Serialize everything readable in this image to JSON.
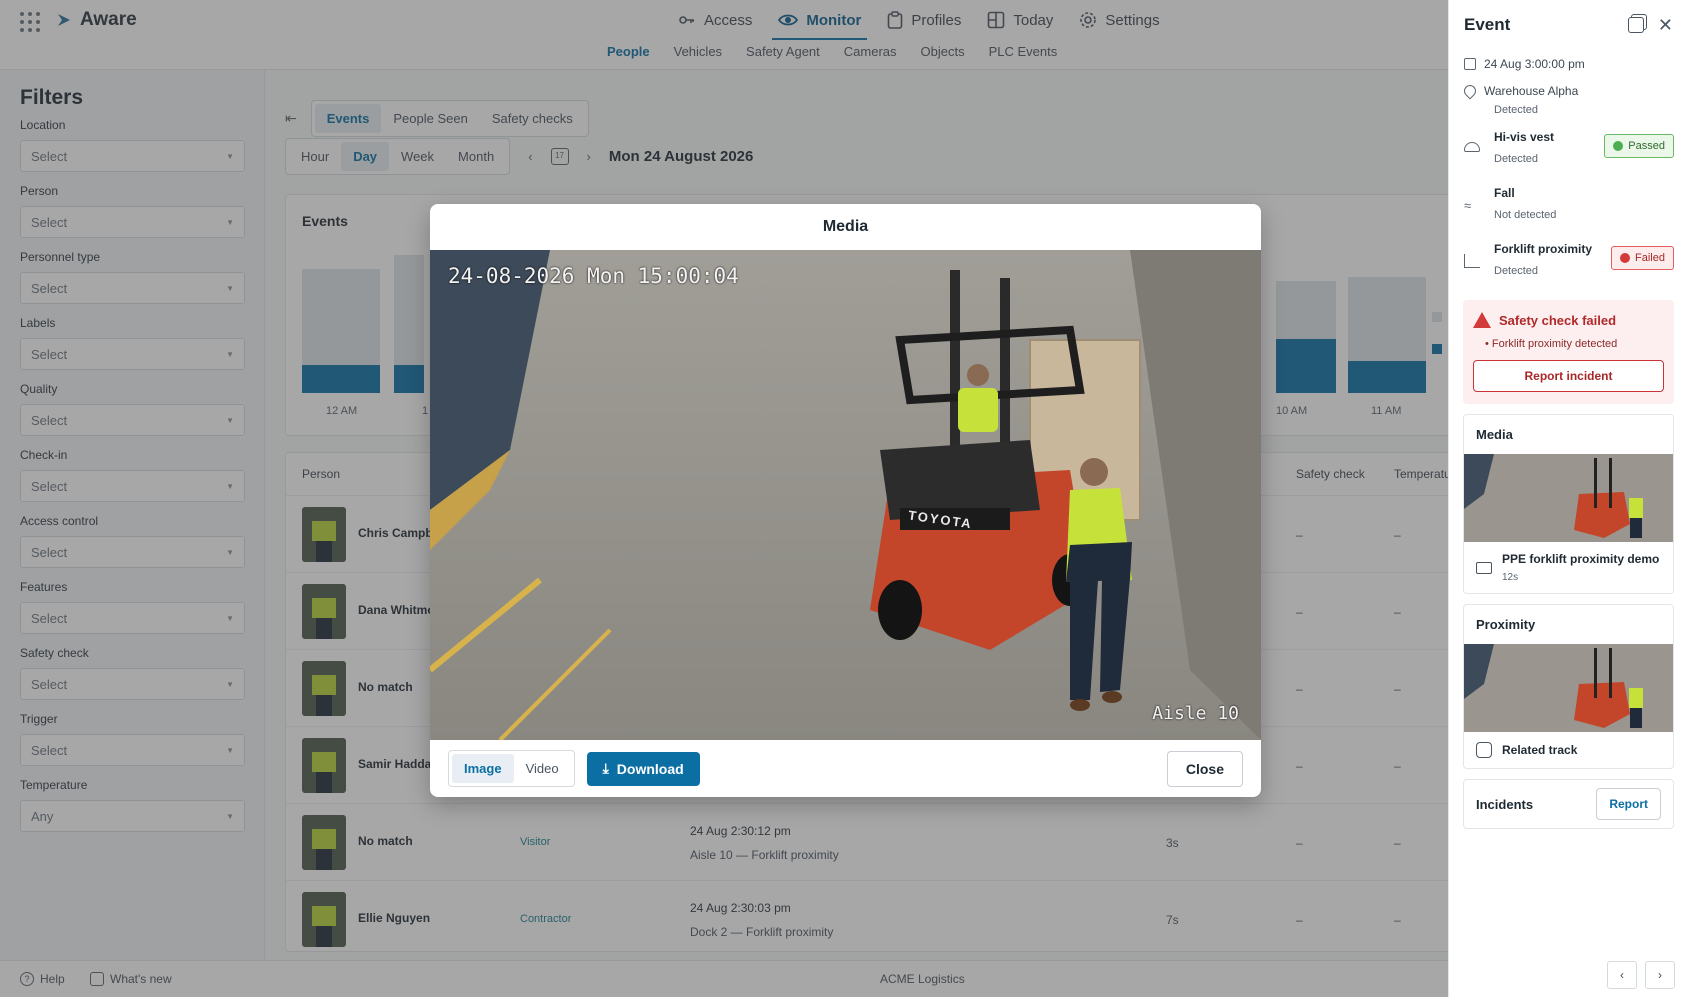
{
  "app": {
    "name": "Aware"
  },
  "nav": {
    "items": [
      {
        "label": "Access",
        "icon": "key-icon"
      },
      {
        "label": "Monitor",
        "icon": "eye-icon",
        "active": true
      },
      {
        "label": "Profiles",
        "icon": "clipboard-icon"
      },
      {
        "label": "Today",
        "icon": "grid-icon"
      },
      {
        "label": "Settings",
        "icon": "gear-icon"
      }
    ],
    "sub": [
      "People",
      "Vehicles",
      "Safety Agent",
      "Cameras",
      "Objects",
      "PLC Events"
    ]
  },
  "filters": {
    "title": "Filters",
    "items": [
      {
        "label": "Location",
        "value": "Select"
      },
      {
        "label": "Person",
        "value": "Select"
      },
      {
        "label": "Personnel type",
        "value": "Select"
      },
      {
        "label": "Labels",
        "value": "Select"
      },
      {
        "label": "Quality",
        "value": "Select"
      },
      {
        "label": "Check-in",
        "value": "Select"
      },
      {
        "label": "Access control",
        "value": "Select"
      },
      {
        "label": "Features",
        "value": "Select"
      },
      {
        "label": "Safety check",
        "value": "Select"
      },
      {
        "label": "Trigger",
        "value": "Select"
      },
      {
        "label": "Temperature",
        "value": "Any"
      }
    ]
  },
  "main": {
    "tabs": [
      "Events",
      "People Seen",
      "Safety checks"
    ],
    "ranges": [
      "Hour",
      "Day",
      "Week",
      "Month"
    ],
    "date": "Mon 24 August 2026",
    "calendar_day": "17",
    "events_title": "Events",
    "chart_ticks": {
      "first": "12 AM",
      "second": "1",
      "penult": "10 AM",
      "last": "11 AM"
    },
    "columns": {
      "person": "Person",
      "safety": "Safety check",
      "temp": "Temperature"
    },
    "rows": [
      {
        "name": "Chris Campb",
        "tag": "",
        "time": "",
        "place": "",
        "dur": "",
        "safety": "–",
        "temp": "–"
      },
      {
        "name": "Dana Whitmo",
        "tag": "",
        "time": "",
        "place": "",
        "dur": "",
        "safety": "–",
        "temp": "–"
      },
      {
        "name": "No match",
        "tag": "",
        "time": "",
        "place": "",
        "dur": "",
        "safety": "–",
        "temp": "–"
      },
      {
        "name": "Samir Hadda",
        "tag": "",
        "time": "",
        "place": "",
        "dur": "",
        "safety": "–",
        "temp": "–"
      },
      {
        "name": "No match",
        "tag": "Visitor",
        "time": "24 Aug 2:30:12 pm",
        "place": "Aisle 10 — Forklift proximity",
        "dur": "3s",
        "safety": "–",
        "temp": "–"
      },
      {
        "name": "Ellie Nguyen",
        "tag": "Contractor",
        "time": "24 Aug 2:30:03 pm",
        "place": "Dock 2 — Forklift proximity",
        "dur": "7s",
        "safety": "–",
        "temp": "–"
      }
    ]
  },
  "modal": {
    "title": "Media",
    "timestamp": "24-08-2026 Mon 15:00:04",
    "camera_label": "Aisle 10",
    "forklift_brand": "TOYOTA",
    "tab_image": "Image",
    "tab_video": "Video",
    "download": "Download",
    "close": "Close"
  },
  "panel": {
    "title": "Event",
    "datetime": "24 Aug 3:00:00 pm",
    "location": "Warehouse Alpha",
    "location_status": "Detected",
    "checks": [
      {
        "title": "Hi-vis vest",
        "status": "Detected",
        "badge": "Passed",
        "kind": "pass"
      },
      {
        "title": "Fall",
        "status": "Not detected",
        "badge": "",
        "kind": ""
      },
      {
        "title": "Forklift proximity",
        "status": "Detected",
        "badge": "Failed",
        "kind": "fail"
      }
    ],
    "alert": {
      "title": "Safety check failed",
      "item": "Forklift proximity detected",
      "button": "Report incident"
    },
    "media": {
      "title": "Media",
      "clip": "PPE forklift proximity demo",
      "duration": "12s"
    },
    "proximity": {
      "title": "Proximity",
      "link": "Related track"
    },
    "incidents": {
      "title": "Incidents",
      "button": "Report"
    }
  },
  "footer": {
    "help": "Help",
    "whats_new": "What's new",
    "org": "ACME Logistics"
  },
  "colors": {
    "accent": "#0b6fa4",
    "fail": "#d33a3a",
    "pass": "#4caf50"
  }
}
